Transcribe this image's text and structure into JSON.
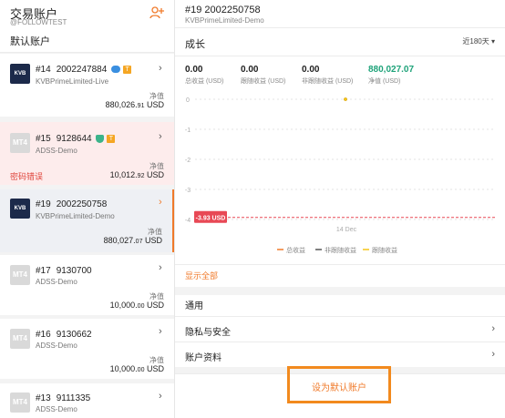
{
  "left": {
    "title": "交易账户",
    "subtitle": "@FOLLOWTEST",
    "section": "默认账户",
    "accounts": [
      {
        "logo": "KVB",
        "id": "#14",
        "number": "2002247884",
        "server": "KVBPrimeLimited-Live",
        "nv_label": "净值",
        "nv_int": "880,026.",
        "nv_dec": "91",
        "currency": "USD",
        "badges": [
          "cloud-icon",
          "trade-icon"
        ]
      },
      {
        "logo": "MT4",
        "id": "#15",
        "number": "9128644",
        "server": "ADSS-Demo",
        "nv_label": "净值",
        "nv_int": "10,012.",
        "nv_dec": "92",
        "currency": "USD",
        "error": "密码错误",
        "badges": [
          "shield-icon",
          "trade-icon"
        ]
      },
      {
        "logo": "KVB",
        "id": "#19",
        "number": "2002250758",
        "server": "KVBPrimeLimited-Demo",
        "nv_label": "净值",
        "nv_int": "880,027.",
        "nv_dec": "07",
        "currency": "USD"
      },
      {
        "logo": "MT4",
        "id": "#17",
        "number": "9130700",
        "server": "ADSS-Demo",
        "nv_label": "净值",
        "nv_int": "10,000.",
        "nv_dec": "00",
        "currency": "USD"
      },
      {
        "logo": "MT4",
        "id": "#16",
        "number": "9130662",
        "server": "ADSS-Demo",
        "nv_label": "净值",
        "nv_int": "10,000.",
        "nv_dec": "00",
        "currency": "USD"
      },
      {
        "logo": "MT4",
        "id": "#13",
        "number": "9111335",
        "server": "ADSS-Demo"
      }
    ],
    "badge_t": "T"
  },
  "right": {
    "title": "#19  2002250758",
    "subtitle": "KVBPrimeLimited-Demo",
    "growth": "成长",
    "period": "近180天 ▾",
    "stats": [
      {
        "value": "0.00",
        "label": "总收益 (USD)"
      },
      {
        "value": "0.00",
        "label": "跟随收益 (USD)"
      },
      {
        "value": "0.00",
        "label": "非跟随收益 (USD)"
      },
      {
        "value": "880,027.07",
        "label": "净值 (USD)"
      }
    ],
    "show_all": "显示全部",
    "general": "通用",
    "menu": [
      "隐私与安全",
      "账户资料"
    ],
    "set_default": "设为默认账户",
    "accent": "#f07a2a",
    "green": "#1fa37a"
  },
  "chart_data": {
    "type": "line",
    "yticks": [
      "0",
      "-1",
      "-2",
      "-3",
      "-4"
    ],
    "ylim": [
      -4,
      0
    ],
    "x": [
      "14 Dec"
    ],
    "marker_label": "-3.93 USD",
    "marker_value": -3.93,
    "series": [
      {
        "name": "总收益",
        "color": "#f07a2a",
        "values": [
          0
        ]
      },
      {
        "name": "非跟随收益",
        "color": "#555555",
        "values": [
          0
        ]
      },
      {
        "name": "跟随收益",
        "color": "#f5c518",
        "values": [
          0
        ]
      }
    ]
  }
}
